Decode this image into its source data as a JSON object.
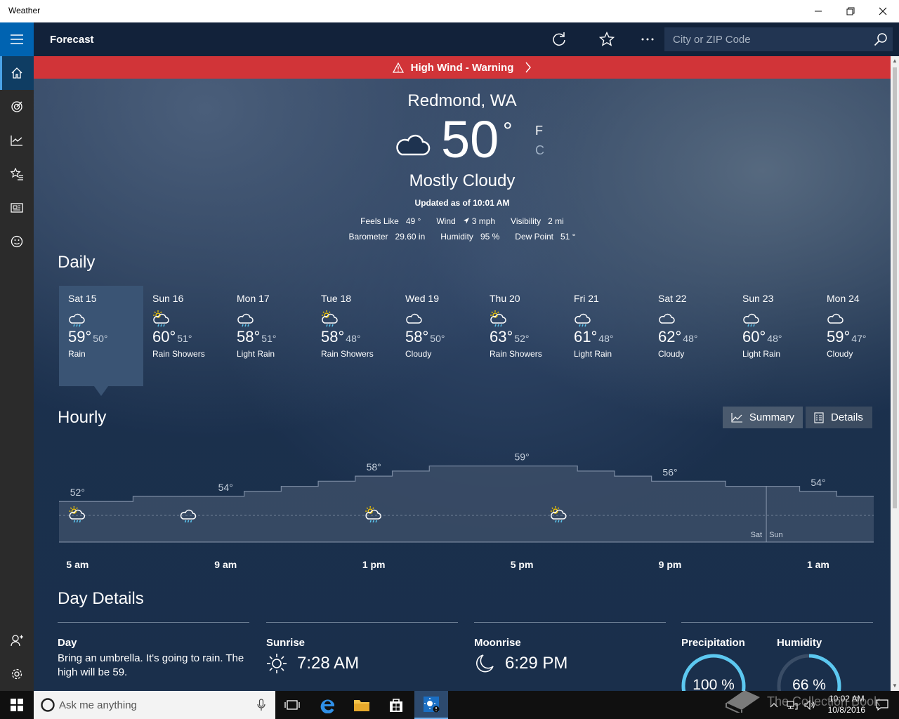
{
  "window": {
    "title": "Weather"
  },
  "header": {
    "title": "Forecast",
    "search_placeholder": "City or ZIP Code"
  },
  "alert": {
    "text": "High Wind - Warning"
  },
  "current": {
    "city": "Redmond, WA",
    "temp": "50",
    "degree": "°",
    "unit_f": "F",
    "unit_c": "C",
    "condition": "Mostly Cloudy",
    "updated": "Updated as of 10:01 AM",
    "feels_like_label": "Feels Like",
    "feels_like": "49 °",
    "wind_label": "Wind",
    "wind": "3 mph",
    "visibility_label": "Visibility",
    "visibility": "2 mi",
    "barometer_label": "Barometer",
    "barometer": "29.60 in",
    "humidity_label": "Humidity",
    "humidity": "95 %",
    "dew_point_label": "Dew Point",
    "dew_point": "51 °"
  },
  "daily": {
    "title": "Daily",
    "days": [
      {
        "name": "Sat 15",
        "high": "59°",
        "low": "50°",
        "cond": "Rain",
        "icon": "rain-cloud-icon"
      },
      {
        "name": "Sun 16",
        "high": "60°",
        "low": "51°",
        "cond": "Rain Showers",
        "icon": "sun-rain-cloud-icon"
      },
      {
        "name": "Mon 17",
        "high": "58°",
        "low": "51°",
        "cond": "Light Rain",
        "icon": "rain-cloud-icon"
      },
      {
        "name": "Tue 18",
        "high": "58°",
        "low": "48°",
        "cond": "Rain Showers",
        "icon": "sun-rain-cloud-icon"
      },
      {
        "name": "Wed 19",
        "high": "58°",
        "low": "50°",
        "cond": "Cloudy",
        "icon": "cloud-icon"
      },
      {
        "name": "Thu 20",
        "high": "63°",
        "low": "52°",
        "cond": "Rain Showers",
        "icon": "sun-rain-cloud-icon"
      },
      {
        "name": "Fri 21",
        "high": "61°",
        "low": "48°",
        "cond": "Light Rain",
        "icon": "rain-cloud-icon"
      },
      {
        "name": "Sat 22",
        "high": "62°",
        "low": "48°",
        "cond": "Cloudy",
        "icon": "cloud-icon"
      },
      {
        "name": "Sun 23",
        "high": "60°",
        "low": "48°",
        "cond": "Light Rain",
        "icon": "rain-cloud-icon"
      },
      {
        "name": "Mon 24",
        "high": "59°",
        "low": "47°",
        "cond": "Cloudy",
        "icon": "cloud-icon"
      }
    ]
  },
  "hourly": {
    "title": "Hourly",
    "summary_label": "Summary",
    "details_label": "Details",
    "day_sat": "Sat",
    "day_sun": "Sun",
    "time_labels": [
      "5 am",
      "9 am",
      "1 pm",
      "5 pm",
      "9 pm",
      "1 am"
    ]
  },
  "chart_data": {
    "type": "area",
    "title": "",
    "xlabel": "",
    "ylabel": "",
    "x": [
      "5 am",
      "6 am",
      "7 am",
      "8 am",
      "9 am",
      "10 am",
      "11 am",
      "12 pm",
      "1 pm",
      "2 pm",
      "3 pm",
      "4 pm",
      "5 pm",
      "6 pm",
      "7 pm",
      "8 pm",
      "9 pm",
      "10 pm",
      "11 pm",
      "12 am",
      "1 am",
      "2 am"
    ],
    "series": [
      {
        "values": [
          52,
          52,
          53,
          53,
          53,
          54,
          55,
          56,
          57,
          58,
          59,
          59,
          59,
          59,
          58,
          57,
          56,
          56,
          55,
          55,
          54,
          53
        ]
      }
    ],
    "labels": [
      {
        "x": "5 am",
        "text": "52°"
      },
      {
        "x": "9 am",
        "text": "54°"
      },
      {
        "x": "1 pm",
        "text": "58°"
      },
      {
        "x": "5 pm",
        "text": "59°"
      },
      {
        "x": "9 pm",
        "text": "56°"
      },
      {
        "x": "1 am",
        "text": "54°"
      }
    ],
    "icons": [
      {
        "x": "5 am",
        "icon": "sun-rain-cloud-icon"
      },
      {
        "x": "8 am",
        "icon": "rain-cloud-icon"
      },
      {
        "x": "1 pm",
        "icon": "sun-rain-cloud-icon"
      },
      {
        "x": "6 pm",
        "icon": "sun-rain-cloud-icon"
      }
    ],
    "ylim": [
      44,
      62
    ],
    "grid": false
  },
  "day_details": {
    "title": "Day Details",
    "day_label": "Day",
    "day_text": "Bring an umbrella. It's going to rain. The high will be 59.",
    "sunrise_label": "Sunrise",
    "sunrise": "7:28 AM",
    "moonrise_label": "Moonrise",
    "moonrise": "6:29 PM",
    "precip_label": "Precipitation",
    "precip": "100 %",
    "precip_value": 100,
    "humidity_label": "Humidity",
    "humidity": "66 %",
    "humidity_value": 66
  },
  "taskbar": {
    "search_placeholder": "Ask me anything",
    "time": "10:02 AM",
    "date": "10/8/2016",
    "watermark": "The Collection Book"
  },
  "colors": {
    "accent": "#0063b1",
    "alert": "#d13438",
    "ring": "#5cc8f0"
  }
}
